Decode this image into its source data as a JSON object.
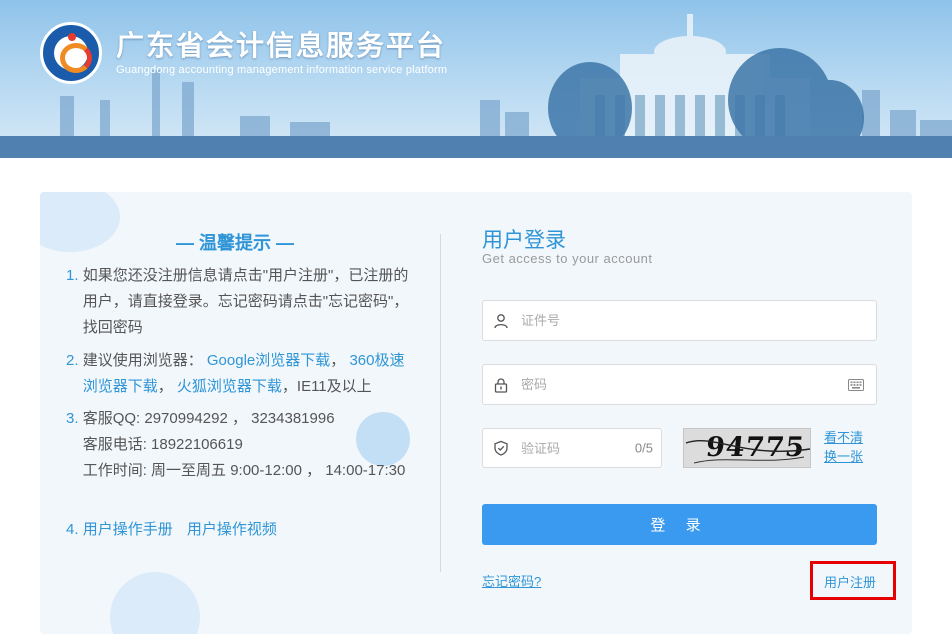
{
  "header": {
    "title": "广东省会计信息服务平台",
    "subtitle": "Guangdong accounting management information service platform"
  },
  "tips": {
    "title": "— 温馨提示 —",
    "item1": {
      "num": "1.",
      "text": "如果您还没注册信息请点击\"用户注册\"，已注册的用户，请直接登录。忘记密码请点击\"忘记密码\"，找回密码"
    },
    "item2": {
      "num": "2.",
      "prefix": "建议使用浏览器：",
      "link_google": "Google浏览器下载",
      "sep1": "，",
      "link_360": "360极速浏览器下载",
      "sep2": "，",
      "link_firefox": "火狐浏览器下载",
      "suffix": "，IE11及以上"
    },
    "item3": {
      "num": "3.",
      "qq": "客服QQ: 2970994292 ， 3234381996",
      "phone": "客服电话: 18922106619",
      "hours": "工作时间: 周一至周五 9:00-12:00 ， 14:00-17:30"
    },
    "item4": {
      "num": "4.",
      "link_manual": "用户操作手册",
      "link_video": "用户操作视频"
    }
  },
  "login": {
    "title": "用户登录",
    "subtitle": "Get access to your account",
    "id_placeholder": "证件号",
    "password_placeholder": "密码",
    "captcha_placeholder": "验证码",
    "captcha_counter": "0/5",
    "captcha_text": "94775",
    "refresh_label": "看不清换一张",
    "login_button": "登 录",
    "forgot_link": "忘记密码?",
    "register_link": "用户注册"
  },
  "colors": {
    "accent": "#2f95d6",
    "button": "#3a9af0",
    "highlight": "#e60000"
  }
}
